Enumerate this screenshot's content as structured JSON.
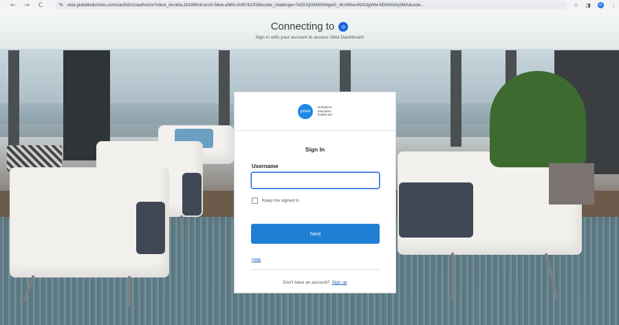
{
  "browser": {
    "url": "okta.globalindustries.com/oauth2/v1/authorize?client_id=okta.2b1959c8-bcc0-56eb-a589-cfcfb7422f26&code_challenge=7wDUQGMS5N4gwG_xKzWhec4tzN3gWbl-NDIWOiAy3MA&code...",
    "icons": {
      "back": "←",
      "forward": "→",
      "reload": "C",
      "site_info": "⇆",
      "bookmark": "☆",
      "extensions": "◨",
      "profile": "G",
      "menu": "⋮"
    }
  },
  "header": {
    "title": "Connecting to",
    "brand_glyph": "◎",
    "subtitle": "Sign in with your account to access Okta Dashboard"
  },
  "card": {
    "logo": {
      "mark": "global",
      "words": [
        "workplace",
        "education",
        "healthcare"
      ]
    },
    "title": "Sign In",
    "username_label": "Username",
    "username_value": "",
    "keep_signed_in_label": "Keep me signed in",
    "keep_signed_in_checked": false,
    "next_label": "Next",
    "help_label": "Help",
    "signup_prompt": "Don't have an account?",
    "signup_link": "Sign up"
  },
  "colors": {
    "primary": "#1f7fd4",
    "link": "#1a5fb4",
    "okta_blue": "#1662dd"
  }
}
